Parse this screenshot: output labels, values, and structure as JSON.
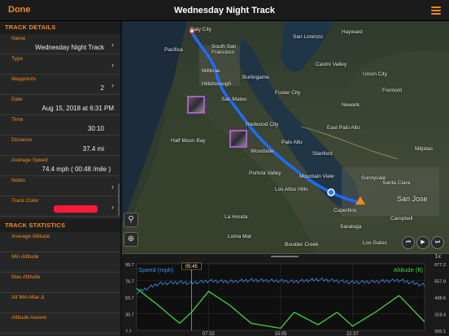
{
  "topbar": {
    "done_label": "Done",
    "title": "Wednesday Night Track"
  },
  "track_details": {
    "header": "TRACK DETAILS",
    "fields": [
      {
        "label": "Name",
        "value": "Wednesday Night Track"
      },
      {
        "label": "Type",
        "value": ""
      },
      {
        "label": "Waypoints",
        "value": "2"
      },
      {
        "label": "Date",
        "value": "Aug 15, 2018 at 6:31 PM"
      },
      {
        "label": "Time",
        "value": "30:10"
      },
      {
        "label": "Distance",
        "value": "37.4 mi"
      },
      {
        "label": "Average Speed",
        "value": "74.4 mph ( 00:48 /mile )"
      },
      {
        "label": "Notes",
        "value": ""
      },
      {
        "label": "Track Color",
        "value": ""
      }
    ],
    "track_color": "#ff1a3c"
  },
  "track_statistics": {
    "header": "TRACK STATISTICS",
    "fields": [
      {
        "label": "Average Altitude"
      },
      {
        "label": "Min Altitude"
      },
      {
        "label": "Max Altitude"
      },
      {
        "label": "Alt Min-Max Δ"
      },
      {
        "label": "Altitude Ascent"
      }
    ]
  },
  "map": {
    "labels": [
      "Daly City",
      "Pacifica",
      "South San Francisco",
      "San Lorenzo",
      "Hayward",
      "Millbrae",
      "Burlingame",
      "Castro Valley",
      "Union City",
      "Hillsborough",
      "San Mateo",
      "Foster City",
      "Fremont",
      "Newark",
      "Redwood City",
      "Milpitas",
      "Half Moon Bay",
      "Palo Alto",
      "East Palo Alto",
      "Woodside",
      "Stanford",
      "Portola Valley",
      "Mountain View",
      "Sunnyvale",
      "San Jose",
      "Cupertino",
      "La Honda",
      "Santa Clara",
      "Los Altos Hills",
      "Saratoga",
      "Campbell",
      "Loma Mar",
      "Boulder Creek",
      "Los Gatos"
    ],
    "zoom_badge": "1x",
    "playback": {
      "rewind": "⏮",
      "play": "▶",
      "forward": "⏭"
    }
  },
  "chart": {
    "speed_label": "Speed (mph)",
    "altitude_label": "Altitude (ft)",
    "speed_axis_ticks": [
      "99.7",
      "76.7",
      "53.7",
      "30.7",
      "7.7"
    ],
    "altitude_axis_ticks": [
      "677.2",
      "557.9",
      "438.6",
      "319.4",
      "200.1"
    ],
    "time_ticks": [
      "07:32",
      "15:05",
      "22:37"
    ],
    "cursor_time": "05:45",
    "speed_color": "#3b8fe8",
    "altitude_color": "#3fd43f"
  },
  "chart_data": {
    "type": "line",
    "title": "",
    "xlabel": "",
    "x": [
      "00:00",
      "02:15",
      "04:30",
      "05:45",
      "07:32",
      "09:45",
      "12:00",
      "15:05",
      "16:30",
      "19:00",
      "21:00",
      "22:37",
      "25:00",
      "27:30",
      "30:10"
    ],
    "series": [
      {
        "name": "Speed (mph)",
        "axis": "left",
        "values": [
          60,
          72,
          74,
          73,
          76,
          75,
          77,
          76,
          75,
          78,
          76,
          74,
          75,
          77,
          70
        ]
      },
      {
        "name": "Altitude (ft)",
        "axis": "right",
        "values": [
          500,
          380,
          250,
          330,
          480,
          380,
          250,
          215,
          330,
          240,
          330,
          230,
          330,
          450,
          260
        ]
      }
    ],
    "ylim_left": [
      7.7,
      99.7
    ],
    "ylim_right": [
      200.1,
      677.2
    ],
    "grid": true
  }
}
